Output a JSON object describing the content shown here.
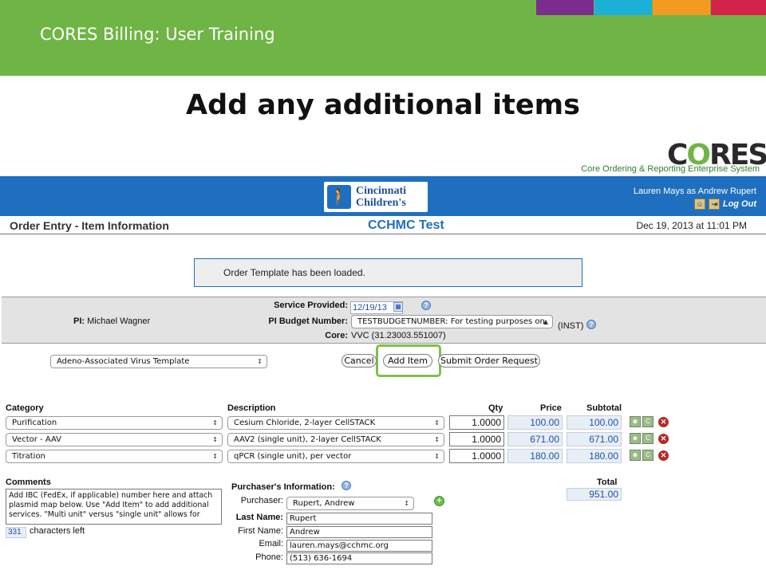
{
  "slide": {
    "header_title": "CORES Billing: User Training",
    "heading": "Add any additional items",
    "accent_colors": [
      "#7b2d8e",
      "#1ab0d8",
      "#f39a22",
      "#d4234a"
    ]
  },
  "logo": {
    "cores_prefix": "C",
    "cores_o": "O",
    "cores_suffix": "RES",
    "tagline": "Core Ordering & Reporting Enterprise System",
    "hospital_line1": "Cincinnati",
    "hospital_line2": "Children's"
  },
  "app_header": {
    "user": "Lauren Mays as Andrew Rupert",
    "logout": "Log Out",
    "page_title": "Order Entry - Item Information",
    "site_title": "CCHMC Test",
    "timestamp": "Dec 19, 2013 at 11:01 PM"
  },
  "message": "Order Template has been loaded.",
  "order_info": {
    "pi_label": "PI:",
    "pi_name": "Michael Wagner",
    "service_label": "Service Provided:",
    "service_date": "12/19/13",
    "budget_label": "PI Budget Number:",
    "budget_value": "TESTBUDGETNUMBER: For testing purposes on",
    "budget_suffix": "(INST)",
    "core_label": "Core:",
    "core_value": "VVC (31.23003.551007)"
  },
  "actions": {
    "template": "Adeno-Associated Virus Template",
    "cancel": "Cancel",
    "add_item": "Add Item",
    "submit": "Submit Order Request"
  },
  "table": {
    "headers": {
      "category": "Category",
      "description": "Description",
      "qty": "Qty",
      "price": "Price",
      "subtotal": "Subtotal"
    },
    "rows": [
      {
        "category": "Purification",
        "description": "Cesium Chloride, 2-layer CellSTACK",
        "qty": "1.0000",
        "price": "100.00",
        "subtotal": "100.00"
      },
      {
        "category": "Vector - AAV",
        "description": "AAV2 (single unit), 2-layer CellSTACK",
        "qty": "1.0000",
        "price": "671.00",
        "subtotal": "671.00"
      },
      {
        "category": "Titration",
        "description": "qPCR (single unit), per vector",
        "qty": "1.0000",
        "price": "180.00",
        "subtotal": "180.00"
      }
    ],
    "total_label": "Total",
    "total_value": "951.00"
  },
  "comments": {
    "label": "Comments",
    "text": "Add IBC (FedEx, if applicable) number here and attach plasmid map below. Use \"Add Item\" to add additional services. \"Multi unit\" versus \"single unit\" allows for",
    "chars_left": "331",
    "chars_label": "characters left"
  },
  "purchaser": {
    "heading": "Purchaser's Information:",
    "purchaser_label": "Purchaser:",
    "purchaser_value": "Rupert, Andrew",
    "last_name_label": "Last Name:",
    "last_name": "Rupert",
    "first_name_label": "First Name:",
    "first_name": "Andrew",
    "email_label": "Email:",
    "email": "lauren.mays@cchmc.org",
    "phone_label": "Phone:",
    "phone": "(513) 636-1694"
  }
}
